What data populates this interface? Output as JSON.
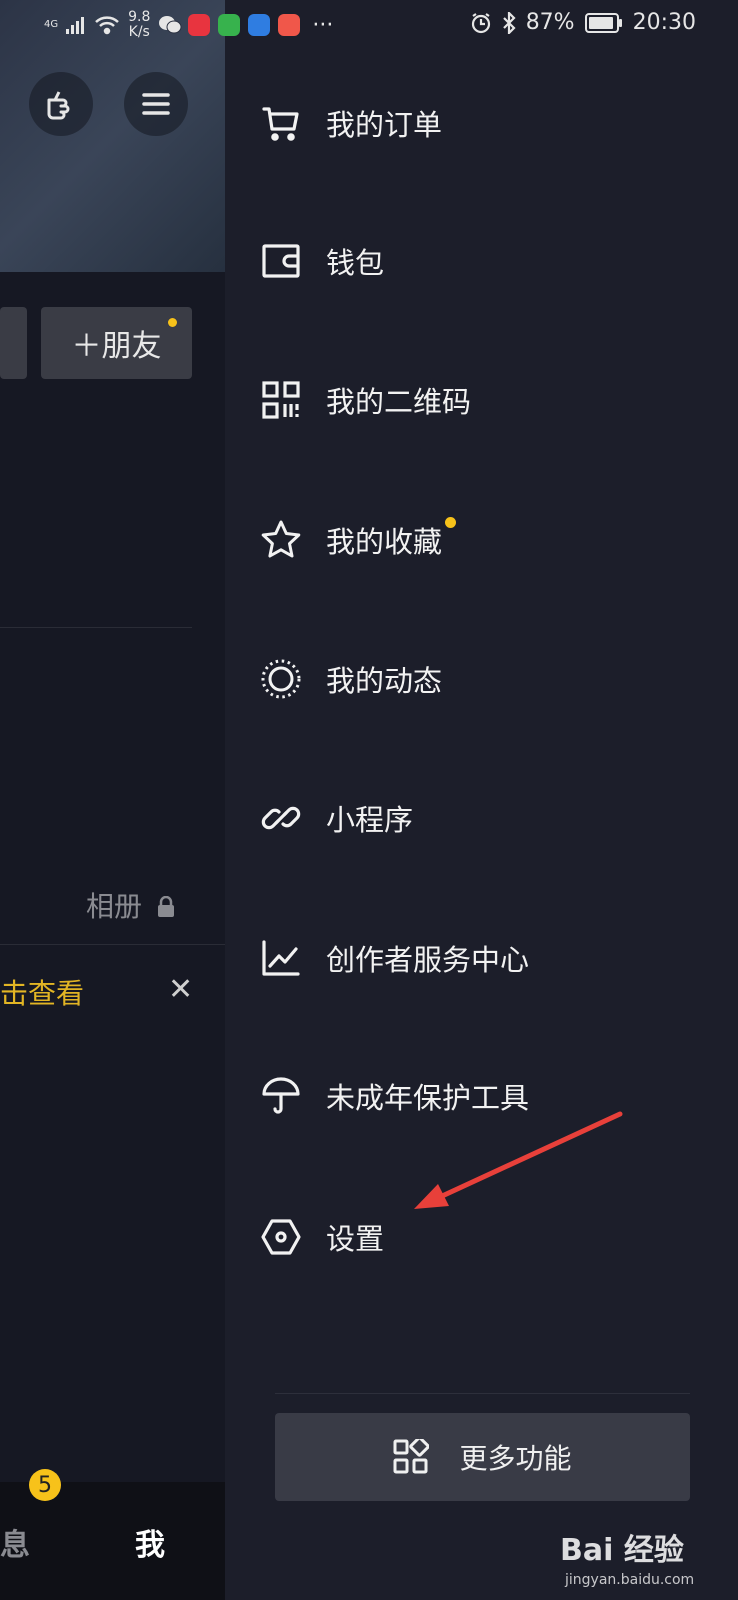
{
  "status_bar": {
    "network": "4G",
    "speed_value": "9.8",
    "speed_unit": "K/s",
    "more": "···",
    "battery": "87%",
    "time": "20:30"
  },
  "background_app": {
    "add_friend_label": "＋朋友",
    "album_label": "相册",
    "view_prompt": "击查看",
    "close_glyph": "✕",
    "messages_tab": "消息",
    "messages_badge": "5",
    "me_tab": "我"
  },
  "drawer": {
    "items": [
      {
        "label": "我的订单",
        "icon": "cart-icon"
      },
      {
        "label": "钱包",
        "icon": "wallet-icon"
      },
      {
        "label": "我的二维码",
        "icon": "qr-code-icon"
      },
      {
        "label": "我的收藏",
        "icon": "star-icon",
        "has_dot": true
      },
      {
        "label": "我的动态",
        "icon": "dotted-circle-icon"
      },
      {
        "label": "小程序",
        "icon": "link-icon"
      },
      {
        "label": "创作者服务中心",
        "icon": "chart-icon"
      },
      {
        "label": "未成年保护工具",
        "icon": "umbrella-icon"
      },
      {
        "label": "设置",
        "icon": "hexagon-settings-icon"
      }
    ],
    "more_label": "更多功能"
  },
  "watermark": {
    "logo_text": "Bai 经验",
    "url": "jingyan.baidu.com"
  },
  "colors": {
    "accent": "#f7c21a",
    "annotation_arrow": "#e8403a",
    "drawer_bg": "#1c1e2a"
  }
}
